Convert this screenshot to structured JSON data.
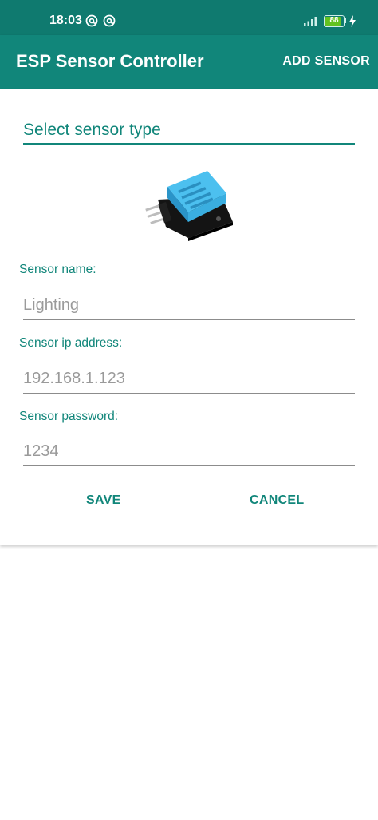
{
  "status_bar": {
    "time": "18:03",
    "battery": "88",
    "battery_level": 0.88,
    "icons": [
      "at-sign-icon",
      "at-sign-icon",
      "signal-icon",
      "battery-icon",
      "charging-bolt-icon"
    ]
  },
  "app_bar": {
    "title": "ESP Sensor Controller",
    "action_label": "ADD SENSOR"
  },
  "form": {
    "sensor_type_placeholder": "Select sensor type",
    "sensor_image_icon": "dht11-sensor-image",
    "name": {
      "label": "Sensor name:",
      "placeholder": "Lighting",
      "value": ""
    },
    "ip": {
      "label": "Sensor ip address:",
      "placeholder": "192.168.1.123",
      "value": ""
    },
    "password": {
      "label": "Sensor password:",
      "placeholder": "1234",
      "value": ""
    },
    "save_label": "SAVE",
    "cancel_label": "CANCEL"
  },
  "colors": {
    "status_bar": "#0f7a6f",
    "app_bar": "#11867a",
    "accent": "#11867a",
    "hint_text": "#9a9a9a",
    "sensor_body": "#3aaee0",
    "board": "#1a1a1a"
  }
}
